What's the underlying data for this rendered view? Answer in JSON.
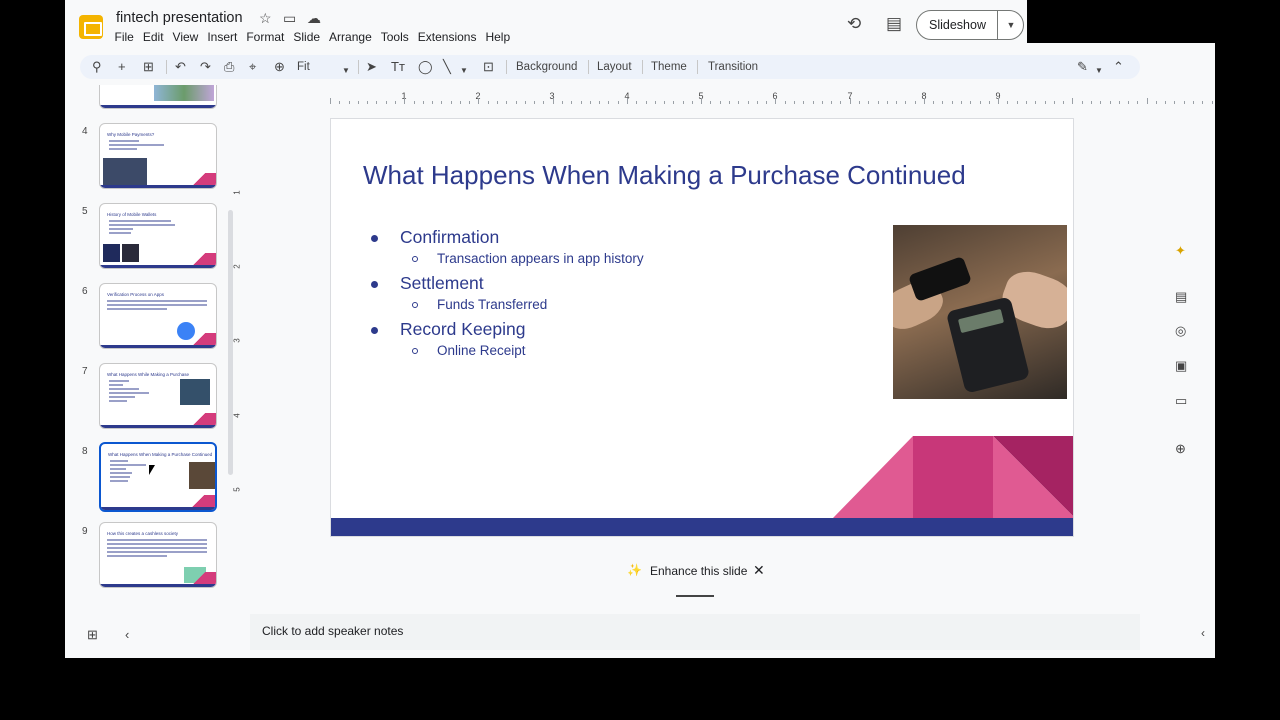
{
  "doc": {
    "title": "fintech presentation"
  },
  "menu": [
    "File",
    "Edit",
    "View",
    "Insert",
    "Format",
    "Slide",
    "Arrange",
    "Tools",
    "Extensions",
    "Help"
  ],
  "header": {
    "slideshow_label": "Slideshow"
  },
  "toolbar": {
    "zoom_value": "Fit",
    "background": "Background",
    "layout": "Layout",
    "theme": "Theme",
    "transition": "Transition"
  },
  "ruler": {
    "h": [
      "1",
      "2",
      "3",
      "4",
      "5",
      "6",
      "7",
      "8",
      "9"
    ],
    "v": [
      "1",
      "2",
      "3",
      "4",
      "5"
    ]
  },
  "filmstrip": [
    {
      "num": "4",
      "title": "Why Mobile Payments?"
    },
    {
      "num": "5",
      "title": "History of Mobile Wallets"
    },
    {
      "num": "6",
      "title": "Verification Process on Apps"
    },
    {
      "num": "7",
      "title": "What Happens While Making a Purchase"
    },
    {
      "num": "8",
      "title": "What Happens When Making a Purchase Continued"
    },
    {
      "num": "9",
      "title": "How this creates a cashless society"
    }
  ],
  "slide": {
    "title": "What Happens When Making a Purchase Continued",
    "bullets": [
      {
        "text": "Confirmation",
        "sub": "Transaction appears in app history"
      },
      {
        "text": "Settlement",
        "sub": "Funds Transferred"
      },
      {
        "text": "Record Keeping",
        "sub": "Online Receipt"
      }
    ]
  },
  "enhance": {
    "label": "Enhance this slide"
  },
  "notes": {
    "placeholder": "Click to add speaker notes"
  },
  "colors": {
    "slide_text": "#2d3a8c",
    "accent_pink": "#d43c7c",
    "active_blue": "#0b57d0"
  },
  "icons": [
    "history-icon",
    "comment-icon",
    "star-icon",
    "move-folder-icon",
    "cloud-icon",
    "search-icon",
    "plus-icon",
    "new-slide-icon",
    "undo-icon",
    "redo-icon",
    "print-icon",
    "paint-format-icon",
    "zoom-icon",
    "select-icon",
    "textbox-icon",
    "shape-icon",
    "line-icon",
    "comment-add-icon",
    "pen-icon",
    "collapse-icon",
    "gemini-icon",
    "keep-icon",
    "tasks-icon",
    "contacts-icon",
    "drive-icon",
    "add-on-icon"
  ]
}
